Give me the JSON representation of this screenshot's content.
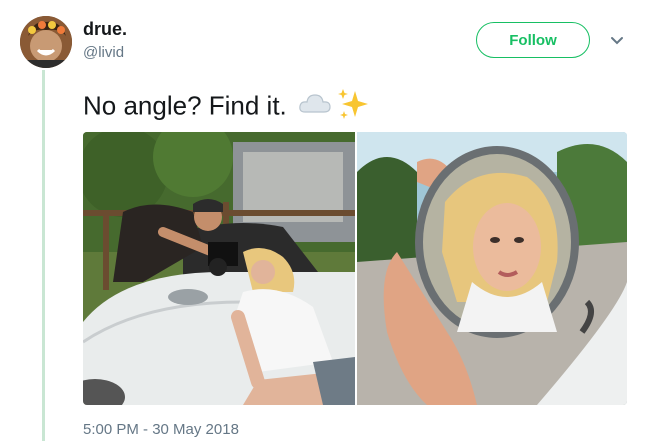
{
  "user": {
    "display_name": "drue.",
    "handle": "@livid"
  },
  "actions": {
    "follow_label": "Follow",
    "more_icon": "chevron-down-icon"
  },
  "tweet": {
    "text": "No angle? Find it.",
    "emojis": [
      "cloud-icon",
      "sparkles-icon"
    ],
    "timestamp": "5:00 PM - 30 May 2018"
  },
  "media": {
    "photos": [
      {
        "label": "photo-1",
        "content": "photographer-and-woman-by-white-car"
      },
      {
        "label": "photo-2",
        "content": "woman-reflected-in-hand-mirror"
      }
    ]
  },
  "colors": {
    "accent": "#17bf63",
    "thread_line": "#c9e6d3",
    "secondary_text": "#657786",
    "primary_text": "#14171a"
  }
}
